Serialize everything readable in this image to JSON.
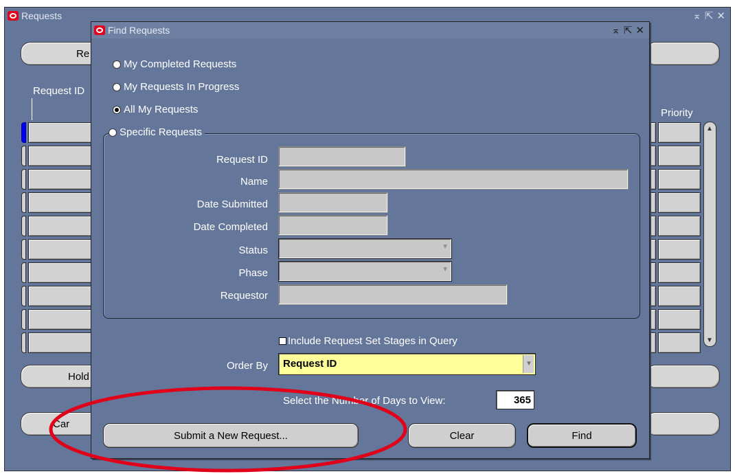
{
  "background_window": {
    "title": "Requests",
    "controls": [
      "⌅",
      "⇱",
      "✕"
    ],
    "refresh_btn_fragment": "Re",
    "column_request_id_fragment": "Request ID",
    "column_priority": "Priority",
    "hold_btn_fragment": "Hold",
    "cancel_btn_fragment": "Car"
  },
  "dialog": {
    "title": "Find Requests",
    "controls": [
      "⌅",
      "⇱",
      "✕"
    ],
    "radios": [
      {
        "label": "My Completed Requests",
        "selected": false
      },
      {
        "label": "My Requests In Progress",
        "selected": false
      },
      {
        "label": "All My Requests",
        "selected": true
      },
      {
        "label": "Specific Requests",
        "selected": false
      }
    ],
    "fields": {
      "request_id_label": "Request ID",
      "name_label": "Name",
      "date_submitted_label": "Date Submitted",
      "date_completed_label": "Date Completed",
      "status_label": "Status",
      "phase_label": "Phase",
      "requestor_label": "Requestor"
    },
    "include_stages_label": "Include Request Set Stages in Query",
    "order_by_label": "Order By",
    "order_by_value": "Request ID",
    "days_label": "Select the Number of Days to View:",
    "days_value": "365",
    "buttons": {
      "submit_new": "Submit a New Request...",
      "clear": "Clear",
      "find": "Find"
    }
  },
  "colors": {
    "window_bg": "#64779a",
    "highlight_field": "#ffff99",
    "annotation_ellipse": "#e0001a"
  }
}
